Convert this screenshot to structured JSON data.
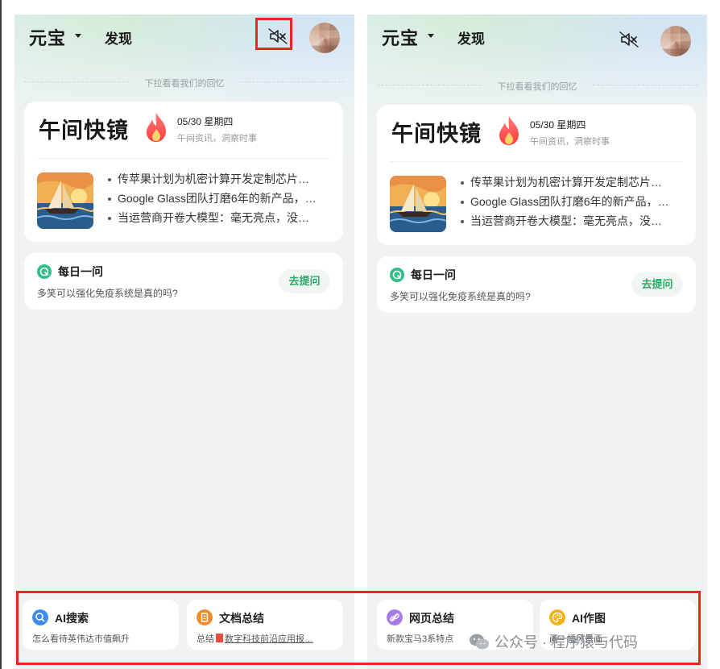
{
  "screens": [
    {
      "app_title": "元宝",
      "tab_discover": "发现",
      "pull_hint": "下拉看看我们的回忆",
      "news": {
        "title": "午间快镜",
        "date": "05/30 星期四",
        "subtitle": "午间资讯，洞察时事",
        "items": [
          "传苹果计划为机密计算开发定制芯片…",
          "Google Glass团队打磨6年的新产品，…",
          "当运营商开卷大模型：毫无亮点，没…"
        ]
      },
      "daily": {
        "title": "每日一问",
        "question": "多笑可以强化免疫系统是真的吗?",
        "ask_button": "去提问"
      },
      "shortcuts": [
        {
          "title": "AI搜索",
          "subtitle": "怎么看待英伟达市值飙升",
          "icon_color": "#3d8bf0",
          "icon": "search-icon"
        },
        {
          "title": "文档总结",
          "subtitle_prefix": "总结",
          "subtitle_doc": "数字科技前沿应用报…",
          "icon_color": "#f08a2c",
          "icon": "document-icon"
        }
      ]
    },
    {
      "app_title": "元宝",
      "tab_discover": "发现",
      "pull_hint": "下拉看看我们的回忆",
      "news": {
        "title": "午间快镜",
        "date": "05/30 星期四",
        "subtitle": "午间资讯，洞察时事",
        "items": [
          "传苹果计划为机密计算开发定制芯片…",
          "Google Glass团队打磨6年的新产品，…",
          "当运营商开卷大模型：毫无亮点，没…"
        ]
      },
      "daily": {
        "title": "每日一问",
        "question": "多笑可以强化免疫系统是真的吗?",
        "ask_button": "去提问"
      },
      "shortcuts": [
        {
          "title": "网页总结",
          "subtitle": "新款宝马3系特点",
          "icon_color": "#a67be8",
          "icon": "link-icon"
        },
        {
          "title": "AI作图",
          "subtitle": "画一幅风景画",
          "icon_color": "#f3b21c",
          "icon": "palette-icon"
        }
      ]
    }
  ],
  "watermark": "公众号 · 程序猿与代码",
  "colors": {
    "highlight": "#e8281e",
    "accent_green": "#2fa86a"
  }
}
